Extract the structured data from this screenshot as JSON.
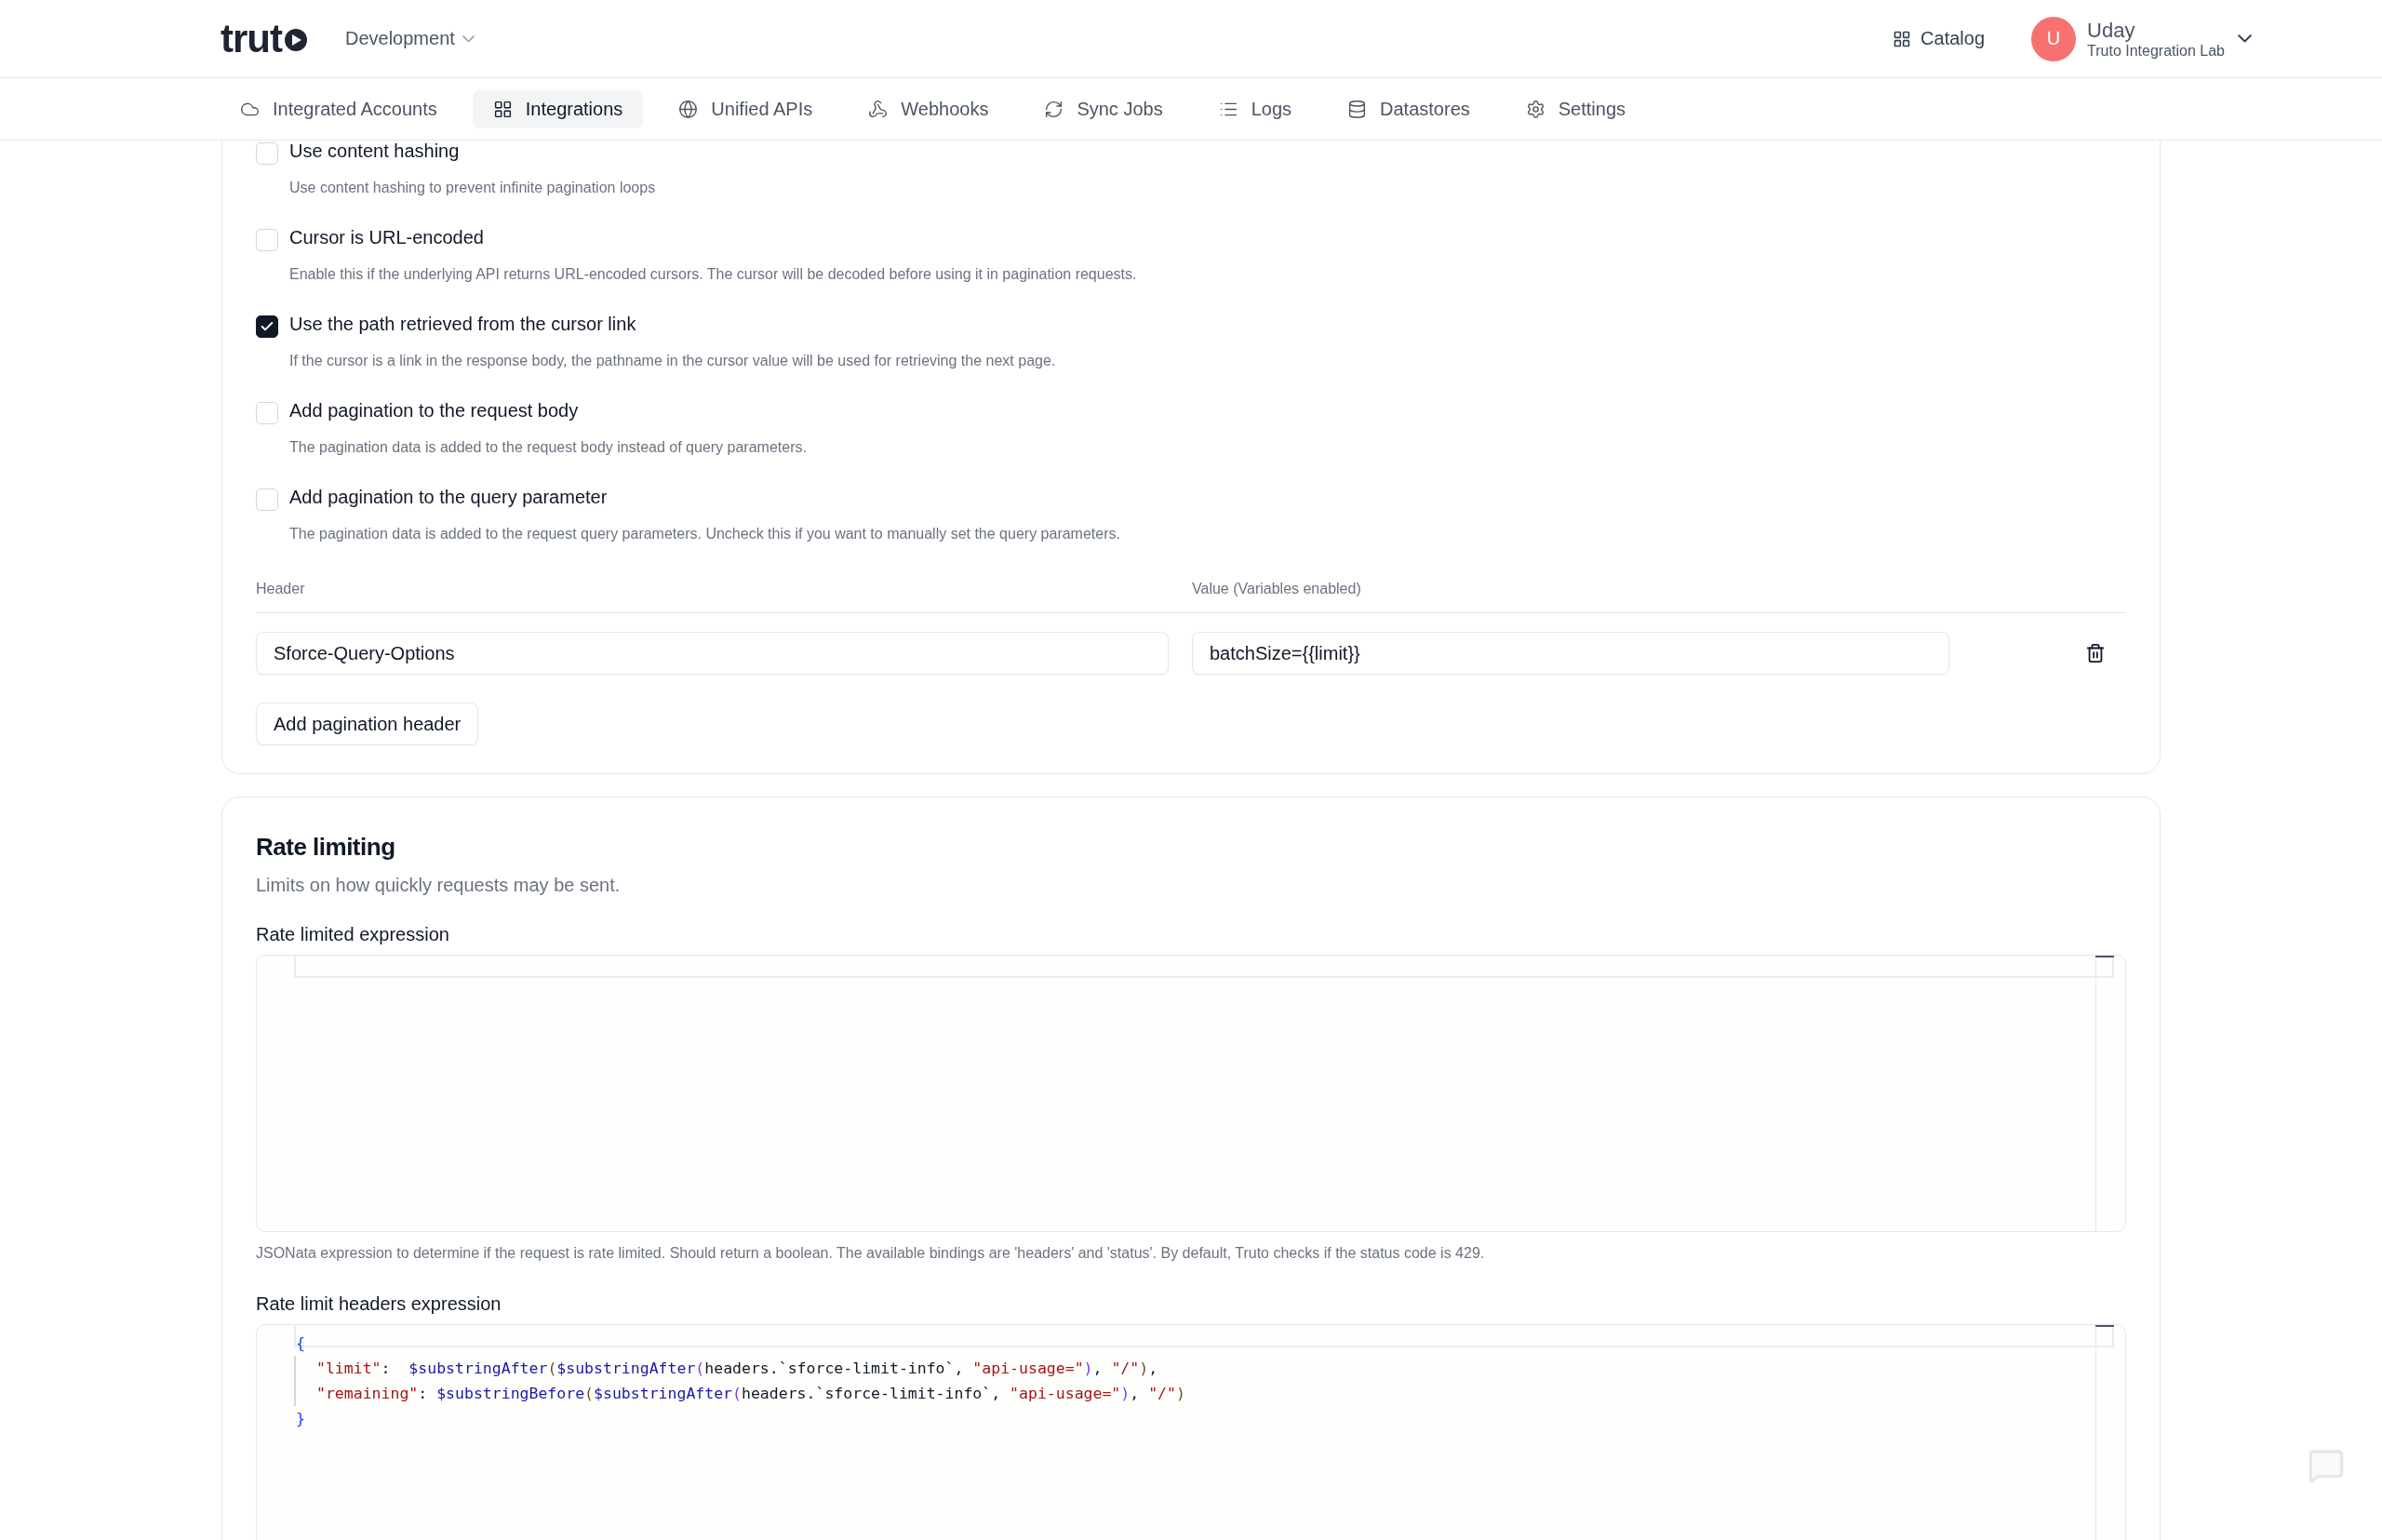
{
  "header": {
    "logo": "trut",
    "environment": "Development",
    "catalog": "Catalog",
    "user": {
      "initial": "U",
      "name": "Uday",
      "team": "Truto Integration Lab"
    }
  },
  "nav": [
    {
      "label": "Integrated Accounts",
      "selected": false
    },
    {
      "label": "Integrations",
      "selected": true
    },
    {
      "label": "Unified APIs",
      "selected": false
    },
    {
      "label": "Webhooks",
      "selected": false
    },
    {
      "label": "Sync Jobs",
      "selected": false
    },
    {
      "label": "Logs",
      "selected": false
    },
    {
      "label": "Datastores",
      "selected": false
    },
    {
      "label": "Settings",
      "selected": false
    }
  ],
  "pagination": {
    "options": [
      {
        "label": "Use content hashing",
        "description": "Use content hashing to prevent infinite pagination loops",
        "checked": false
      },
      {
        "label": "Cursor is URL-encoded",
        "description": "Enable this if the underlying API returns URL-encoded cursors. The cursor will be decoded before using it in pagination requests.",
        "checked": false
      },
      {
        "label": "Use the path retrieved from the cursor link",
        "description": "If the cursor is a link in the response body, the pathname in the cursor value will be used for retrieving the next page.",
        "checked": true
      },
      {
        "label": "Add pagination to the request body",
        "description": "The pagination data is added to the request body instead of query parameters.",
        "checked": false
      },
      {
        "label": "Add pagination to the query parameter",
        "description": "The pagination data is added to the request query parameters. Uncheck this if you want to manually set the query parameters.",
        "checked": false
      }
    ],
    "columns": [
      "Header",
      "Value (Variables enabled)"
    ],
    "rows": [
      {
        "header": "Sforce-Query-Options",
        "value": "batchSize={{limit}}"
      }
    ],
    "add_button": "Add pagination header"
  },
  "rate_limiting": {
    "title": "Rate limiting",
    "subtitle": "Limits on how quickly requests may be sent.",
    "expression_label": "Rate limited expression",
    "expression_help": "JSONata expression to determine if the request is rate limited. Should return a boolean. The available bindings are 'headers' and 'status'. By default, Truto checks if the status code is 429.",
    "headers_label": "Rate limit headers expression",
    "code": [
      [
        {
          "kind": "brace",
          "text": "{"
        }
      ],
      [
        {
          "kind": "key",
          "text": "\"limit\""
        },
        {
          "kind": "plain",
          "text": ":  "
        },
        {
          "kind": "func",
          "text": "$substringAfter"
        },
        {
          "kind": "paren1",
          "text": "("
        },
        {
          "kind": "func",
          "text": "$substringAfter"
        },
        {
          "kind": "paren2",
          "text": "("
        },
        {
          "kind": "plain",
          "text": "headers.`sforce-limit-info`, "
        },
        {
          "kind": "string",
          "text": "\"api-usage=\""
        },
        {
          "kind": "paren2",
          "text": ")"
        },
        {
          "kind": "plain",
          "text": ", "
        },
        {
          "kind": "string",
          "text": "\"/\""
        },
        {
          "kind": "paren1",
          "text": ")"
        },
        {
          "kind": "plain",
          "text": ","
        }
      ],
      [
        {
          "kind": "key",
          "text": "\"remaining\""
        },
        {
          "kind": "plain",
          "text": ": "
        },
        {
          "kind": "func",
          "text": "$substringBefore"
        },
        {
          "kind": "paren1",
          "text": "("
        },
        {
          "kind": "func",
          "text": "$substringAfter"
        },
        {
          "kind": "paren2",
          "text": "("
        },
        {
          "kind": "plain",
          "text": "headers.`sforce-limit-info`, "
        },
        {
          "kind": "string",
          "text": "\"api-usage=\""
        },
        {
          "kind": "paren2",
          "text": ")"
        },
        {
          "kind": "plain",
          "text": ", "
        },
        {
          "kind": "string",
          "text": "\"/\""
        },
        {
          "kind": "paren1",
          "text": ")"
        }
      ],
      [
        {
          "kind": "brace",
          "text": "}"
        }
      ]
    ]
  }
}
